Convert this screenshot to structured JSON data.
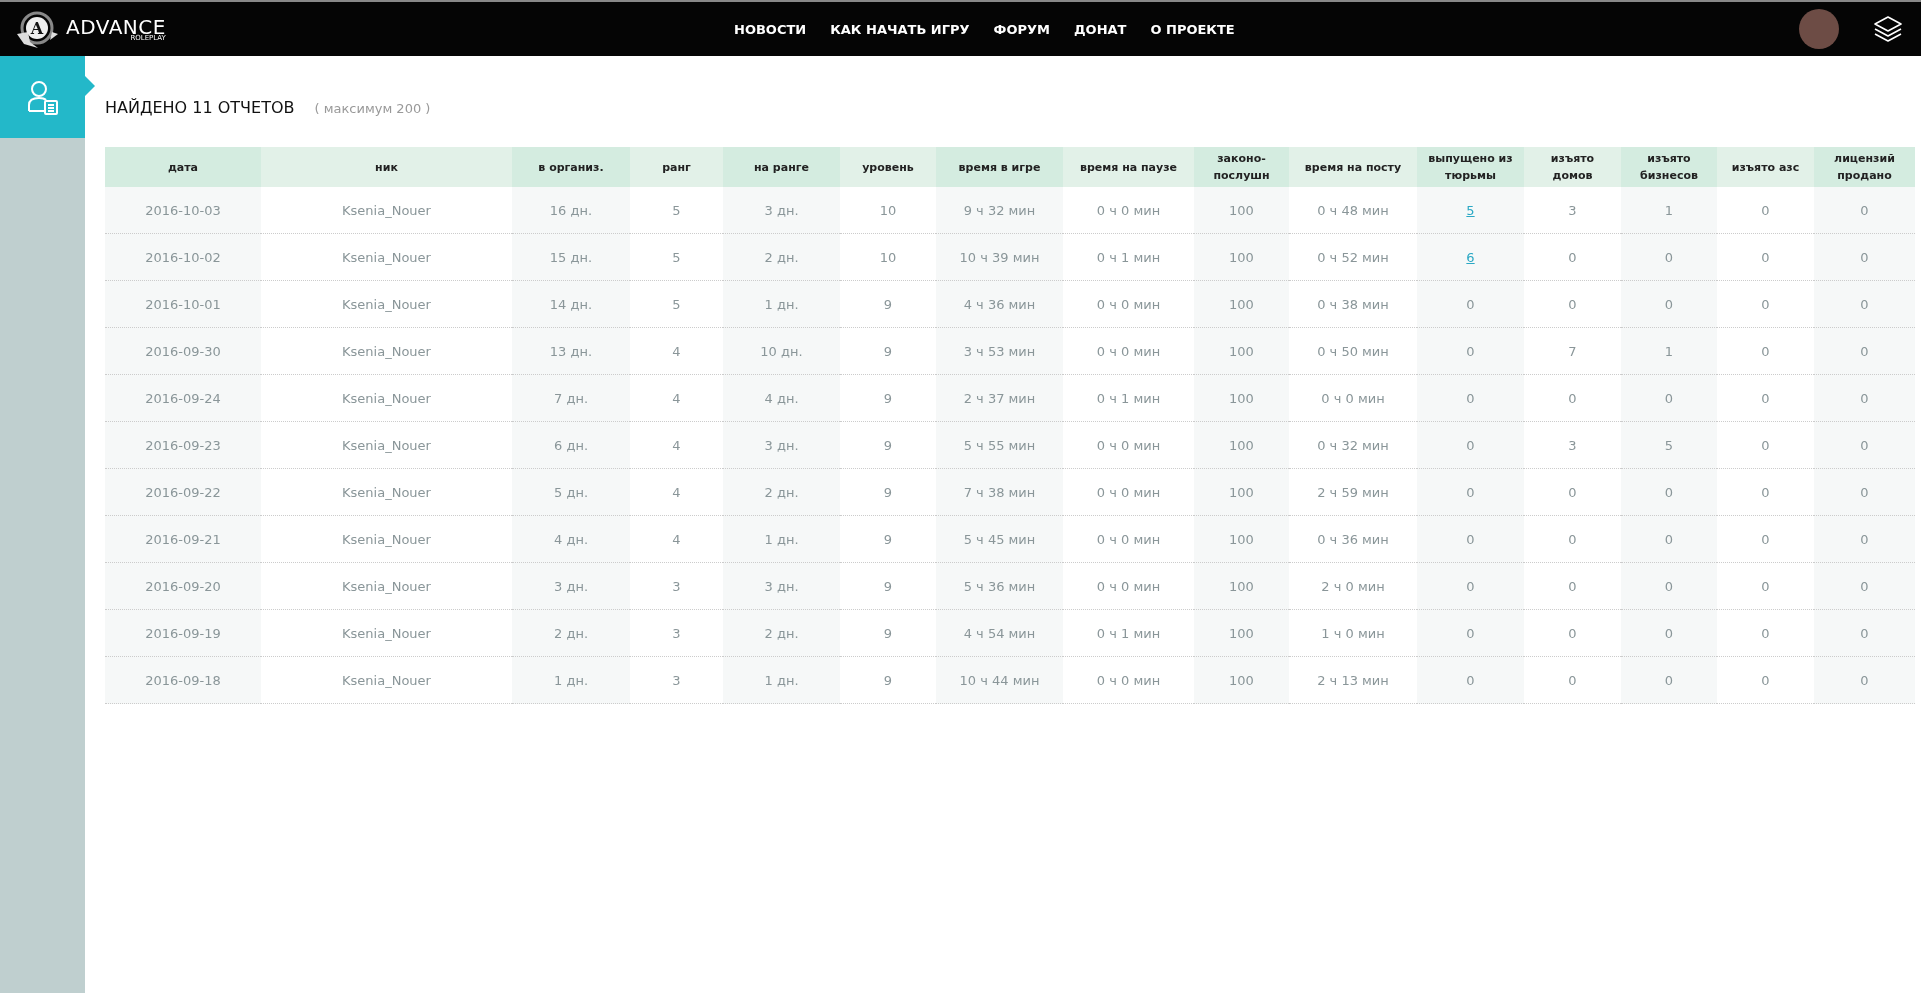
{
  "header": {
    "logo": {
      "name": "ADVANCE",
      "subtitle": "ROLEPLAY",
      "letter": "A"
    },
    "nav": [
      "НОВОСТИ",
      "КАК НАЧАТЬ ИГРУ",
      "ФОРУМ",
      "ДОНАТ",
      "О ПРОЕКТЕ"
    ]
  },
  "report": {
    "title": "НАЙДЕНО 11 ОТЧЕТОВ",
    "note": "( максимум 200 )"
  },
  "table": {
    "columns": [
      "дата",
      "ник",
      "в организ.",
      "ранг",
      "на ранге",
      "уровень",
      "время в игре",
      "время на паузе",
      "законо-послушн",
      "время на посту",
      "выпущено из тюрьмы",
      "изъято домов",
      "изъято бизнесов",
      "изъято азс",
      "лицензий продано"
    ],
    "rows": [
      [
        {
          "text": "2016-10-03"
        },
        {
          "text": "Ksenia_Nouer"
        },
        {
          "text": "16 дн."
        },
        {
          "text": "5"
        },
        {
          "text": "3 дн."
        },
        {
          "text": "10"
        },
        {
          "text": "9 ч 32 мин"
        },
        {
          "text": "0 ч 0 мин"
        },
        {
          "text": "100"
        },
        {
          "text": "0 ч 48 мин"
        },
        {
          "text": "5",
          "kind": "link"
        },
        {
          "text": "3"
        },
        {
          "text": "1"
        },
        {
          "text": "0"
        },
        {
          "text": "0"
        }
      ],
      [
        {
          "text": "2016-10-02"
        },
        {
          "text": "Ksenia_Nouer"
        },
        {
          "text": "15 дн."
        },
        {
          "text": "5"
        },
        {
          "text": "2 дн."
        },
        {
          "text": "10"
        },
        {
          "text": "10 ч 39 мин"
        },
        {
          "text": "0 ч 1 мин"
        },
        {
          "text": "100"
        },
        {
          "text": "0 ч 52 мин"
        },
        {
          "text": "6",
          "kind": "link"
        },
        {
          "text": "0"
        },
        {
          "text": "0"
        },
        {
          "text": "0"
        },
        {
          "text": "0"
        }
      ],
      [
        {
          "text": "2016-10-01"
        },
        {
          "text": "Ksenia_Nouer"
        },
        {
          "text": "14 дн."
        },
        {
          "text": "5"
        },
        {
          "text": "1 дн."
        },
        {
          "text": "9"
        },
        {
          "text": "4 ч 36 мин"
        },
        {
          "text": "0 ч 0 мин"
        },
        {
          "text": "100"
        },
        {
          "text": "0 ч 38 мин"
        },
        {
          "text": "0"
        },
        {
          "text": "0"
        },
        {
          "text": "0"
        },
        {
          "text": "0"
        },
        {
          "text": "0"
        }
      ],
      [
        {
          "text": "2016-09-30"
        },
        {
          "text": "Ksenia_Nouer"
        },
        {
          "text": "13 дн."
        },
        {
          "text": "4"
        },
        {
          "text": "10 дн."
        },
        {
          "text": "9"
        },
        {
          "text": "3 ч 53 мин"
        },
        {
          "text": "0 ч 0 мин"
        },
        {
          "text": "100"
        },
        {
          "text": "0 ч 50 мин"
        },
        {
          "text": "0"
        },
        {
          "text": "7"
        },
        {
          "text": "1"
        },
        {
          "text": "0"
        },
        {
          "text": "0"
        }
      ],
      [
        {
          "text": "2016-09-24"
        },
        {
          "text": "Ksenia_Nouer"
        },
        {
          "text": "7 дн."
        },
        {
          "text": "4"
        },
        {
          "text": "4 дн."
        },
        {
          "text": "9"
        },
        {
          "text": "2 ч 37 мин"
        },
        {
          "text": "0 ч 1 мин"
        },
        {
          "text": "100"
        },
        {
          "text": "0 ч 0 мин"
        },
        {
          "text": "0"
        },
        {
          "text": "0"
        },
        {
          "text": "0"
        },
        {
          "text": "0"
        },
        {
          "text": "0"
        }
      ],
      [
        {
          "text": "2016-09-23"
        },
        {
          "text": "Ksenia_Nouer"
        },
        {
          "text": "6 дн."
        },
        {
          "text": "4"
        },
        {
          "text": "3 дн."
        },
        {
          "text": "9"
        },
        {
          "text": "5 ч 55 мин"
        },
        {
          "text": "0 ч 0 мин"
        },
        {
          "text": "100"
        },
        {
          "text": "0 ч 32 мин"
        },
        {
          "text": "0"
        },
        {
          "text": "3"
        },
        {
          "text": "5"
        },
        {
          "text": "0"
        },
        {
          "text": "0"
        }
      ],
      [
        {
          "text": "2016-09-22"
        },
        {
          "text": "Ksenia_Nouer"
        },
        {
          "text": "5 дн."
        },
        {
          "text": "4"
        },
        {
          "text": "2 дн."
        },
        {
          "text": "9"
        },
        {
          "text": "7 ч 38 мин"
        },
        {
          "text": "0 ч 0 мин"
        },
        {
          "text": "100"
        },
        {
          "text": "2 ч 59 мин"
        },
        {
          "text": "0"
        },
        {
          "text": "0"
        },
        {
          "text": "0"
        },
        {
          "text": "0"
        },
        {
          "text": "0"
        }
      ],
      [
        {
          "text": "2016-09-21"
        },
        {
          "text": "Ksenia_Nouer"
        },
        {
          "text": "4 дн."
        },
        {
          "text": "4"
        },
        {
          "text": "1 дн."
        },
        {
          "text": "9"
        },
        {
          "text": "5 ч 45 мин"
        },
        {
          "text": "0 ч 0 мин"
        },
        {
          "text": "100"
        },
        {
          "text": "0 ч 36 мин"
        },
        {
          "text": "0"
        },
        {
          "text": "0"
        },
        {
          "text": "0"
        },
        {
          "text": "0"
        },
        {
          "text": "0"
        }
      ],
      [
        {
          "text": "2016-09-20"
        },
        {
          "text": "Ksenia_Nouer"
        },
        {
          "text": "3 дн."
        },
        {
          "text": "3"
        },
        {
          "text": "3 дн."
        },
        {
          "text": "9"
        },
        {
          "text": "5 ч 36 мин"
        },
        {
          "text": "0 ч 0 мин"
        },
        {
          "text": "100"
        },
        {
          "text": "2 ч 0 мин"
        },
        {
          "text": "0"
        },
        {
          "text": "0"
        },
        {
          "text": "0"
        },
        {
          "text": "0"
        },
        {
          "text": "0"
        }
      ],
      [
        {
          "text": "2016-09-19"
        },
        {
          "text": "Ksenia_Nouer"
        },
        {
          "text": "2 дн."
        },
        {
          "text": "3"
        },
        {
          "text": "2 дн."
        },
        {
          "text": "9"
        },
        {
          "text": "4 ч 54 мин"
        },
        {
          "text": "0 ч 1 мин"
        },
        {
          "text": "100"
        },
        {
          "text": "1 ч 0 мин"
        },
        {
          "text": "0"
        },
        {
          "text": "0"
        },
        {
          "text": "0"
        },
        {
          "text": "0"
        },
        {
          "text": "0"
        }
      ],
      [
        {
          "text": "2016-09-18"
        },
        {
          "text": "Ksenia_Nouer"
        },
        {
          "text": "1 дн."
        },
        {
          "text": "3"
        },
        {
          "text": "1 дн."
        },
        {
          "text": "9"
        },
        {
          "text": "10 ч 44 мин"
        },
        {
          "text": "0 ч 0 мин"
        },
        {
          "text": "100"
        },
        {
          "text": "2 ч 13 мин"
        },
        {
          "text": "0"
        },
        {
          "text": "0"
        },
        {
          "text": "0"
        },
        {
          "text": "0"
        },
        {
          "text": "0"
        }
      ]
    ]
  }
}
